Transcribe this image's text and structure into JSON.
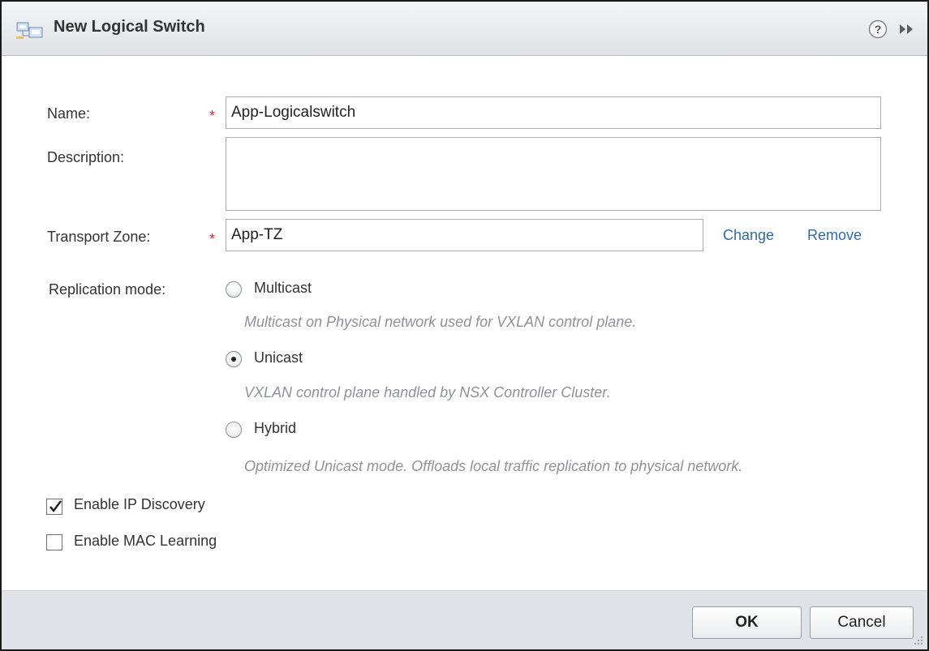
{
  "dialog": {
    "title": "New Logical Switch",
    "icons": {
      "title": "logical-switch-icon",
      "help": "help-icon",
      "expand": "expand-icon"
    }
  },
  "form": {
    "name_label": "Name:",
    "name_value": "App-Logicalswitch",
    "description_label": "Description:",
    "description_value": "",
    "transport_zone_label": "Transport Zone:",
    "transport_zone_value": "App-TZ",
    "change_link": "Change",
    "remove_link": "Remove",
    "required_marker": "*",
    "replication_label": "Replication mode:",
    "replication_options": [
      {
        "label": "Multicast",
        "hint": "Multicast on Physical network used for VXLAN control plane.",
        "selected": false
      },
      {
        "label": "Unicast",
        "hint": "VXLAN control plane handled by NSX Controller Cluster.",
        "selected": true
      },
      {
        "label": "Hybrid",
        "hint": "Optimized Unicast mode. Offloads local traffic replication to physical network.",
        "selected": false
      }
    ],
    "ip_discovery_label": "Enable IP Discovery",
    "ip_discovery_checked": true,
    "mac_learning_label": "Enable MAC Learning",
    "mac_learning_checked": false
  },
  "footer": {
    "ok_label": "OK",
    "cancel_label": "Cancel"
  },
  "colors": {
    "required": "#d8262e",
    "link": "#2d6ab0",
    "hint": "#8e9297",
    "footer_bg": "#dfe2e6"
  }
}
